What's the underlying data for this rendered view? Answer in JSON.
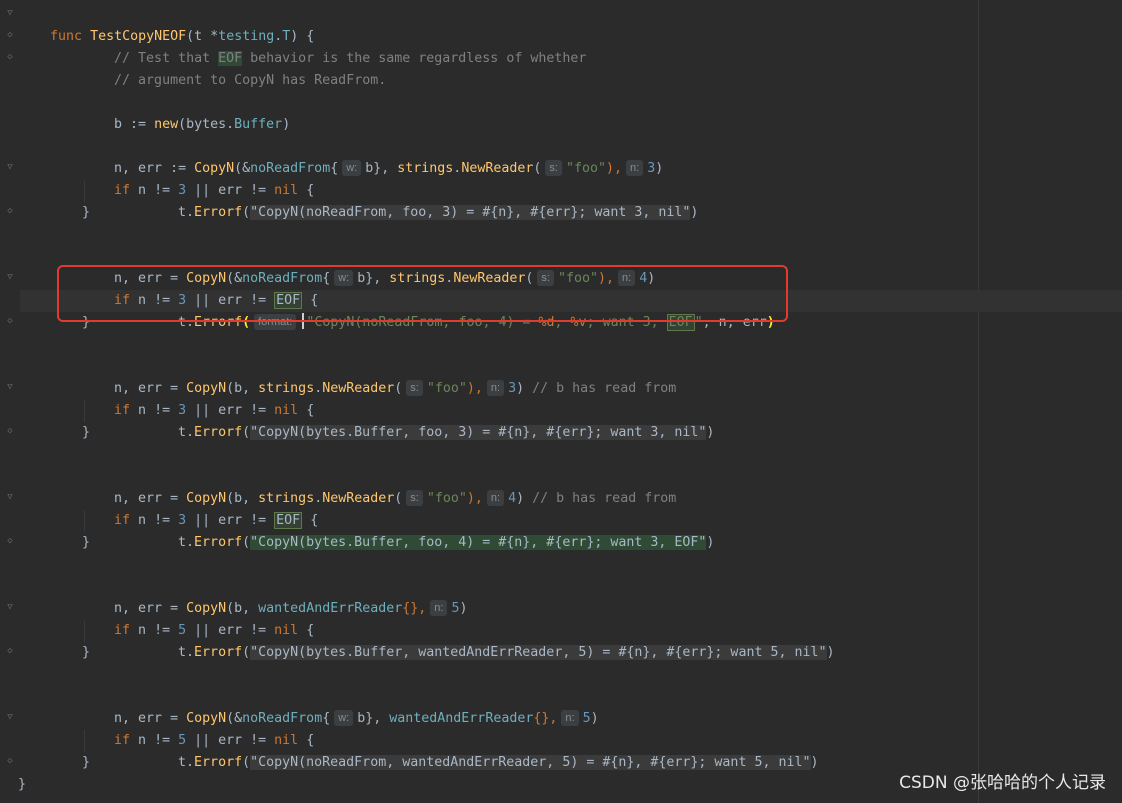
{
  "editor": {
    "watermark": "CSDN @张哈哈的个人记录",
    "colors": {
      "background": "#2b2b2b",
      "keyword": "#cc7832",
      "function": "#ffc66d",
      "type": "#6fafbd",
      "number": "#6897bb",
      "string": "#6a8759",
      "comment": "#808080",
      "highlight_box": "#e23b2e"
    },
    "code": {
      "l1": {
        "kw": "func",
        "fn": "TestCopyNEOF",
        "p1": "(t *",
        "ty": "testing",
        "p2": ".",
        "ty2": "T",
        "p3": ") {"
      },
      "l2": {
        "c1": "// Test that ",
        "eof": "EOF",
        "c2": " behavior is the same regardless of whether"
      },
      "l3": {
        "c": "// argument to CopyN has ReadFrom."
      },
      "l5": {
        "a": "b := ",
        "kw": "new",
        "b": "(bytes.",
        "ty": "Buffer",
        "c": ")"
      },
      "l7": {
        "a": "n, err := ",
        "fn": "CopyN",
        "b": "(&",
        "ty": "noReadFrom",
        "c": "{",
        "h1": "w:",
        "d": "b}, ",
        "fn2": "strings",
        "e": ".",
        "fn3": "NewReader",
        "f": "(",
        "h2": "s:",
        "s": "\"foo\"",
        "g": "),",
        "h3": "n:",
        "n": "3",
        "z": ")"
      },
      "l8": {
        "kw": "if",
        "a": " n != ",
        "n": "3",
        "b": " || err != ",
        "nil": "nil",
        "c": " {"
      },
      "l9": {
        "a": "t.",
        "fn": "Errorf",
        "b": "(",
        "s": "\"CopyN(noReadFrom, foo, 3) = #{n}, #{err}; want 3, nil\"",
        "c": ")"
      },
      "l10": {
        "a": "}"
      },
      "l12": {
        "a": "n, err = ",
        "fn": "CopyN",
        "b": "(&",
        "ty": "noReadFrom",
        "c": "{",
        "h1": "w:",
        "d": "b}, ",
        "fn2": "strings",
        "e": ".",
        "fn3": "NewReader",
        "f": "(",
        "h2": "s:",
        "s": "\"foo\"",
        "g": "),",
        "h3": "n:",
        "n": "4",
        "z": ")"
      },
      "l13": {
        "kw": "if",
        "a": " n != ",
        "n": "3",
        "b": " || err != ",
        "eof": "EOF",
        "c": " {"
      },
      "l14": {
        "a": "t.",
        "fn": "Errorf",
        "p": "(",
        "h": "format:",
        "s1": "\"CopyN(noReadFrom, foo, 4) = ",
        "f1": "%d",
        "s2": ", ",
        "f2": "%v",
        "s3": "; want 3, ",
        "eof": "EOF",
        "s4": "\"",
        "c": ", n, err",
        "p2": ")"
      },
      "l15": {
        "a": "}"
      },
      "l17": {
        "a": "n, err = ",
        "fn": "CopyN",
        "b": "(b, ",
        "fn2": "strings",
        "e": ".",
        "fn3": "NewReader",
        "f": "(",
        "h2": "s:",
        "s": "\"foo\"",
        "g": "),",
        "h3": "n:",
        "n": "3",
        "z": ")",
        "cm": " // b has read from"
      },
      "l18": {
        "kw": "if",
        "a": " n != ",
        "n": "3",
        "b": " || err != ",
        "nil": "nil",
        "c": " {"
      },
      "l19": {
        "a": "t.",
        "fn": "Errorf",
        "b": "(",
        "s": "\"CopyN(bytes.Buffer, foo, 3) = #{n}, #{err}; want 3, nil\"",
        "c": ")"
      },
      "l20": {
        "a": "}"
      },
      "l22": {
        "a": "n, err = ",
        "fn": "CopyN",
        "b": "(b, ",
        "fn2": "strings",
        "e": ".",
        "fn3": "NewReader",
        "f": "(",
        "h2": "s:",
        "s": "\"foo\"",
        "g": "),",
        "h3": "n:",
        "n": "4",
        "z": ")",
        "cm": " // b has read from"
      },
      "l23": {
        "kw": "if",
        "a": " n != ",
        "n": "3",
        "b": " || err != ",
        "eof": "EOF",
        "c": " {"
      },
      "l24": {
        "a": "t.",
        "fn": "Errorf",
        "b": "(",
        "s": "\"CopyN(bytes.Buffer, foo, 4) = #{n}, #{err}; want 3, EOF\"",
        "c": ")"
      },
      "l25": {
        "a": "}"
      },
      "l27": {
        "a": "n, err = ",
        "fn": "CopyN",
        "b": "(b, ",
        "ty": "wantedAndErrReader",
        "c": "{},",
        "h3": "n:",
        "n": "5",
        "z": ")"
      },
      "l28": {
        "kw": "if",
        "a": " n != ",
        "n": "5",
        "b": " || err != ",
        "nil": "nil",
        "c": " {"
      },
      "l29": {
        "a": "t.",
        "fn": "Errorf",
        "b": "(",
        "s": "\"CopyN(bytes.Buffer, wantedAndErrReader, 5) = #{n}, #{err}; want 5, nil\"",
        "c": ")"
      },
      "l30": {
        "a": "}"
      },
      "l32": {
        "a": "n, err = ",
        "fn": "CopyN",
        "b": "(&",
        "ty": "noReadFrom",
        "c": "{",
        "h1": "w:",
        "d": "b}, ",
        "ty2": "wantedAndErrReader",
        "e": "{},",
        "h3": "n:",
        "n": "5",
        "z": ")"
      },
      "l33": {
        "kw": "if",
        "a": " n != ",
        "n": "5",
        "b": " || err != ",
        "nil": "nil",
        "c": " {"
      },
      "l34": {
        "a": "t.",
        "fn": "Errorf",
        "b": "(",
        "s": "\"CopyN(noReadFrom, wantedAndErrReader, 5) = #{n}, #{err}; want 5, nil\"",
        "c": ")"
      },
      "l35": {
        "a": "}"
      },
      "l36": {
        "a": "}"
      }
    }
  }
}
